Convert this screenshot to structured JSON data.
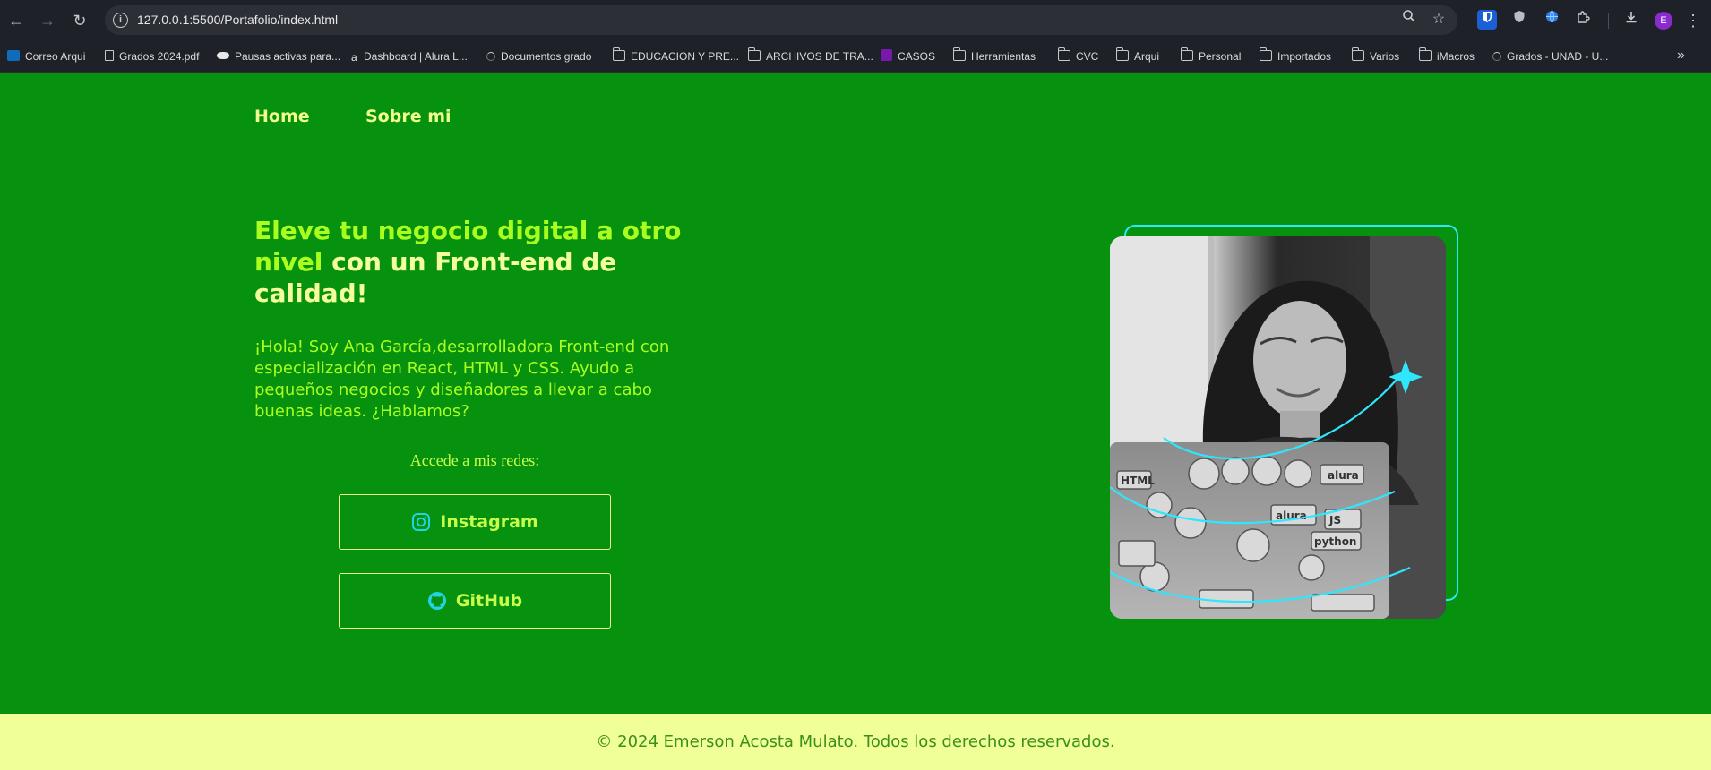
{
  "browser": {
    "url": "127.0.0.1:5500/Portafolio/index.html",
    "profile_initial": "E",
    "bookmarks": [
      {
        "label": "Correo Arqui",
        "icon": "outlook-icon"
      },
      {
        "label": "Grados 2024.pdf",
        "icon": "file-icon"
      },
      {
        "label": "Pausas activas para...",
        "icon": "eye-icon"
      },
      {
        "label": "Dashboard | Alura L...",
        "icon": "alura-icon"
      },
      {
        "label": "Documentos grado",
        "icon": "loading-icon"
      },
      {
        "label": "EDUCACION Y PRE...",
        "icon": "folder-icon"
      },
      {
        "label": "ARCHIVOS DE TRA...",
        "icon": "folder-icon"
      },
      {
        "label": "CASOS",
        "icon": "onenote-icon"
      },
      {
        "label": "Herramientas",
        "icon": "folder-icon"
      },
      {
        "label": "CVC",
        "icon": "folder-icon"
      },
      {
        "label": "Arqui",
        "icon": "folder-icon"
      },
      {
        "label": "Personal",
        "icon": "folder-icon"
      },
      {
        "label": "Importados",
        "icon": "folder-icon"
      },
      {
        "label": "Varios",
        "icon": "folder-icon"
      },
      {
        "label": "iMacros",
        "icon": "folder-icon"
      },
      {
        "label": "Grados - UNAD - U...",
        "icon": "loading-icon"
      }
    ]
  },
  "nav": {
    "home": "Home",
    "about": "Sobre mi"
  },
  "hero": {
    "title_highlight": "Eleve tu negocio digital a otro nivel",
    "title_rest": " con un Front-end de calidad!",
    "text": "¡Hola! Soy Ana García,desarrolladora Front-end con especialización en React, HTML y CSS. Ayudo a pequeños negocios y diseñadores a llevar a cabo buenas ideas. ¿Hablamos?",
    "social_heading": "Accede a mis redes:",
    "instagram_label": "Instagram",
    "github_label": "GitHub"
  },
  "footer": {
    "text": "© 2024 Emerson Acosta Mulato. Todos los derechos reservados."
  },
  "colors": {
    "background": "#06910f",
    "title": "#f3ff9a",
    "accent": "#a9ff1e",
    "frame": "#2ee7ff",
    "footer_bg": "#f0ff96"
  }
}
